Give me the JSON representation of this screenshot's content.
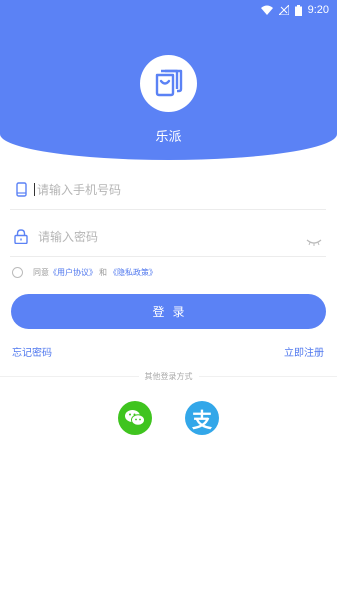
{
  "status_bar": {
    "time": "9:20"
  },
  "app": {
    "name": "乐派"
  },
  "phone_field": {
    "placeholder": "请输入手机号码"
  },
  "password_field": {
    "placeholder": "请输入密码"
  },
  "agreement": {
    "prefix": "同意",
    "user_agreement": "《用户协议》",
    "and": "和",
    "privacy_policy": "《隐私政策》"
  },
  "login_button": {
    "label": "登录"
  },
  "links": {
    "forgot_password": "忘记密码",
    "register": "立即注册"
  },
  "other_login": {
    "label": "其他登录方式",
    "alipay_glyph": "支"
  },
  "colors": {
    "primary": "#5b82f5",
    "link": "#4f77ee",
    "wechat": "#3fc41f",
    "alipay": "#33a7e9"
  }
}
